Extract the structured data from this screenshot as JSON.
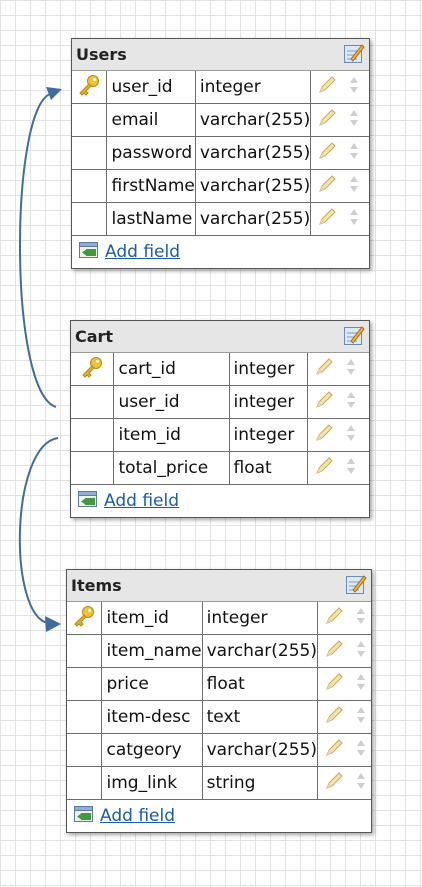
{
  "tables": [
    {
      "title": "Users",
      "fields": [
        {
          "name": "user_id",
          "type": "integer",
          "primary_key": true
        },
        {
          "name": "email",
          "type": "varchar(255)",
          "primary_key": false
        },
        {
          "name": "password",
          "type": "varchar(255)",
          "primary_key": false
        },
        {
          "name": "firstName",
          "type": "varchar(255)",
          "primary_key": false
        },
        {
          "name": "lastName",
          "type": "varchar(255)",
          "primary_key": false
        }
      ],
      "add_label": "Add field"
    },
    {
      "title": "Cart",
      "fields": [
        {
          "name": "cart_id",
          "type": "integer",
          "primary_key": true
        },
        {
          "name": "user_id",
          "type": "integer",
          "primary_key": false
        },
        {
          "name": "item_id",
          "type": "integer",
          "primary_key": false
        },
        {
          "name": "total_price",
          "type": "float",
          "primary_key": false
        }
      ],
      "add_label": "Add field"
    },
    {
      "title": "Items",
      "fields": [
        {
          "name": "item_id",
          "type": "integer",
          "primary_key": true
        },
        {
          "name": "item_name",
          "type": "varchar(255)",
          "primary_key": false
        },
        {
          "name": "price",
          "type": "float",
          "primary_key": false
        },
        {
          "name": "item-desc",
          "type": "text",
          "primary_key": false
        },
        {
          "name": "catgeory",
          "type": "varchar(255)",
          "primary_key": false
        },
        {
          "name": "img_link",
          "type": "string",
          "primary_key": false
        }
      ],
      "add_label": "Add field"
    }
  ],
  "relations": [
    {
      "from": "Cart.user_id",
      "to": "Users.user_id"
    },
    {
      "from": "Cart.item_id",
      "to": "Items.item_id"
    }
  ],
  "colors": {
    "connector": "#3f6e9e",
    "link": "#1b5ea8",
    "header": "#e6e6e6"
  }
}
